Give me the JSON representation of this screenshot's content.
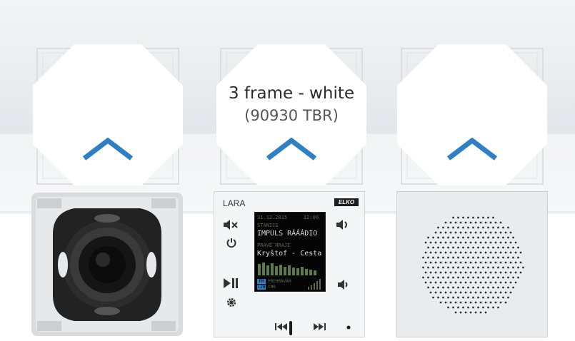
{
  "product": {
    "title": "3 frame - white",
    "code": "(90930 TBR)"
  },
  "colors": {
    "accent": "#2f7fc4",
    "frame": "#eceef0"
  },
  "radio": {
    "brand": "LARA",
    "logo": "ELKO",
    "screen": {
      "datetime_left": "31.12.2015",
      "datetime_right": "12:00",
      "station_label": "STANICE",
      "station_name": "IMPULS RÁÁÁDIO",
      "now_label": "PRÁVĚ HRAJE",
      "now_playing": "Kryštof - Cesta",
      "status_a": "FM",
      "status_b": "128",
      "status_text": "PŘEHRÁVÁM",
      "status_text2": "CMR"
    },
    "icons": [
      "mute-icon",
      "power-icon",
      "volume-icon",
      "play-pause-icon",
      "settings-icon",
      "volume-down-icon",
      "prev-icon",
      "next-icon"
    ]
  }
}
